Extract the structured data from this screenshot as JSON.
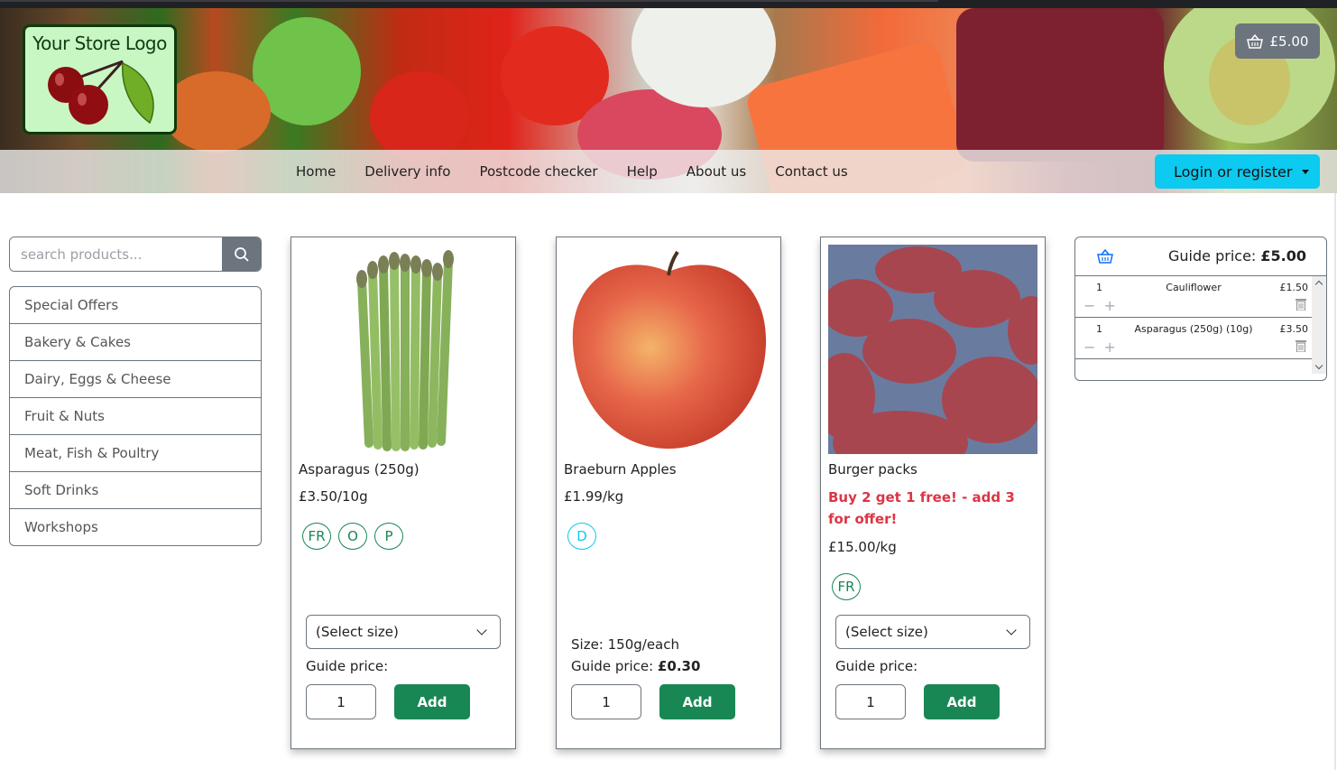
{
  "header": {
    "logo_text": "Your Store Logo",
    "cart_total": "£5.00",
    "nav": [
      "Home",
      "Delivery info",
      "Postcode checker",
      "Help",
      "About us",
      "Contact us"
    ],
    "login_label": "Login or register"
  },
  "sidebar": {
    "search_placeholder": "search products...",
    "categories": [
      "Special Offers",
      "Bakery & Cakes",
      "Dairy, Eggs & Cheese",
      "Fruit & Nuts",
      "Meat, Fish & Poultry",
      "Soft Drinks",
      "Workshops"
    ]
  },
  "products": [
    {
      "name": "Asparagus (250g)",
      "price": "£3.50/10g",
      "badges": [
        "FR",
        "O",
        "P"
      ],
      "size_select": "(Select size)",
      "guide_label": "Guide price:",
      "quantity": "1",
      "add_label": "Add"
    },
    {
      "name": "Braeburn Apples",
      "price": "£1.99/kg",
      "badges": [
        "D"
      ],
      "size_text": "Size: 150g/each",
      "guide_label": "Guide price:",
      "guide_value": "£0.30",
      "quantity": "1",
      "add_label": "Add"
    },
    {
      "name": "Burger packs",
      "offer": "Buy 2 get 1 free! - add 3 for offer!",
      "price": "£15.00/kg",
      "badges": [
        "FR"
      ],
      "size_select": "(Select size)",
      "guide_label": "Guide price:",
      "quantity": "1",
      "add_label": "Add"
    }
  ],
  "basket": {
    "guide_label": "Guide price:",
    "total": "£5.00",
    "items": [
      {
        "qty": "1",
        "name": "Cauliflower",
        "price": "£1.50"
      },
      {
        "qty": "1",
        "name": "Asparagus (250g) (10g)",
        "price": "£3.50"
      }
    ],
    "controls": "− +"
  },
  "colors": {
    "primary_green": "#198754",
    "info_cyan": "#0dcaf0",
    "offer_red": "#dc3545",
    "secondary_gray": "#6c757d"
  }
}
